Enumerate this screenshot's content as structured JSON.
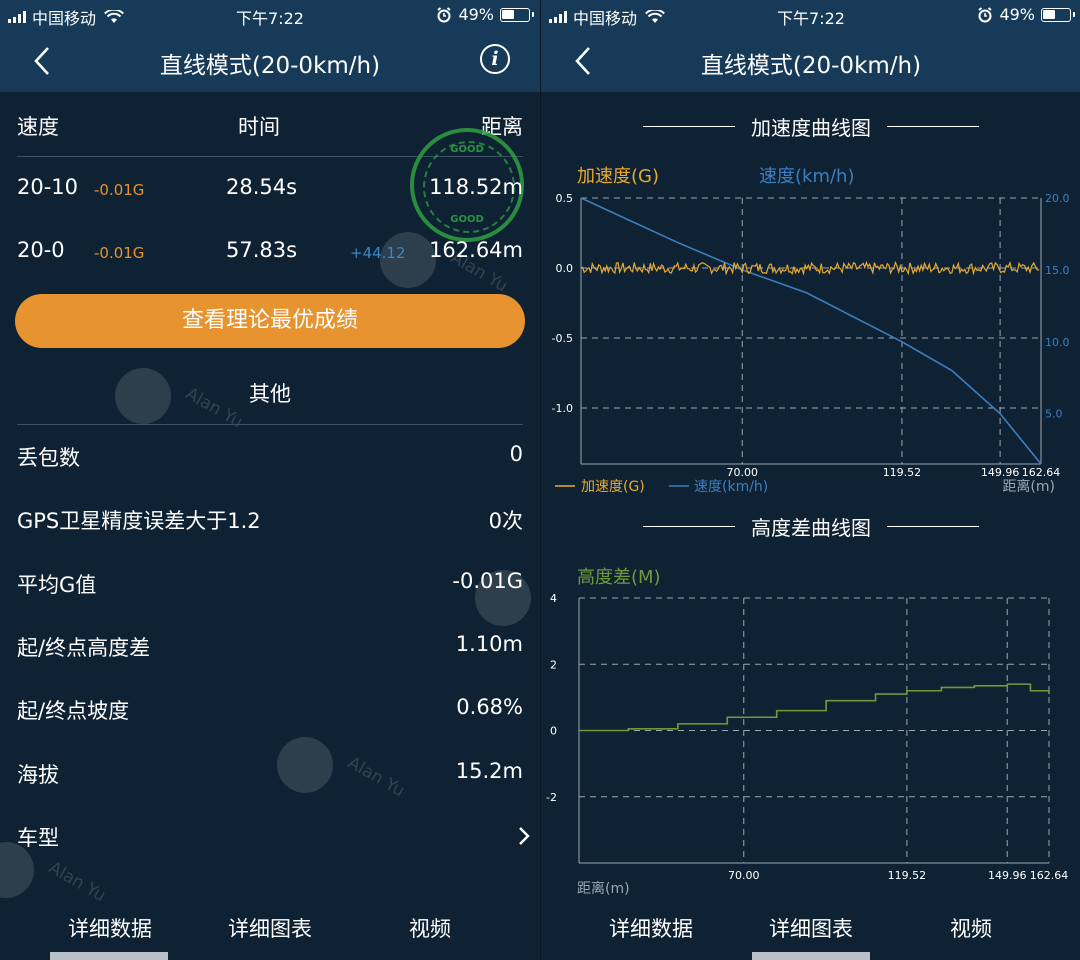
{
  "status": {
    "carrier": "中国移动",
    "time": "下午7:22",
    "battery": "49%"
  },
  "left": {
    "title": "直线模式(20-0km/h)",
    "table": {
      "headers": [
        "速度",
        "时间",
        "距离"
      ],
      "rows": [
        {
          "speed": "20-10",
          "g": "-0.01G",
          "time": "28.54s",
          "extra": "",
          "distance": "118.52m"
        },
        {
          "speed": "20-0",
          "g": "-0.01G",
          "time": "57.83s",
          "extra": "+44.12",
          "distance": "162.64m"
        }
      ]
    },
    "button": "查看理论最优成绩",
    "other_title": "其他",
    "stamp_text": "GOOD",
    "watermark": "Alan Yu",
    "items": [
      {
        "label": "丢包数",
        "value": "0"
      },
      {
        "label": "GPS卫星精度误差大于1.2",
        "value": "0次"
      },
      {
        "label": "平均G值",
        "value": "-0.01G"
      },
      {
        "label": "起/终点高度差",
        "value": "1.10m"
      },
      {
        "label": "起/终点坡度",
        "value": "0.68%"
      },
      {
        "label": "海拔",
        "value": "15.2m"
      },
      {
        "label": "车型",
        "value": ""
      }
    ]
  },
  "right": {
    "title": "直线模式(20-0km/h)",
    "accel_title": "加速度曲线图",
    "height_title": "高度差曲线图"
  },
  "tabs": [
    "详细数据",
    "详细图表",
    "视频"
  ],
  "colors": {
    "accent": "#e7932f",
    "header": "#163a57",
    "background": "#0e2233",
    "accel_line": "#e8a930",
    "speed_line": "#3b7fc1",
    "height_line": "#6f9a3c"
  },
  "chart_data": [
    {
      "type": "line",
      "title": "加速度曲线图",
      "xlabel": "距离(m)",
      "x_ticks": [
        "70.00",
        "119.52",
        "149.96",
        "162.64"
      ],
      "xlim": [
        20.0,
        162.64
      ],
      "y_left_label": "加速度(G)",
      "y_left_ticks": [
        "0.5",
        "0.0",
        "-0.5",
        "-1.0"
      ],
      "y_left_lim": [
        -1.4,
        0.5
      ],
      "y_right_label": "速度(km/h)",
      "y_right_ticks": [
        "20.0",
        "15.0",
        "10.0",
        "5.0"
      ],
      "y_right_lim": [
        1.5,
        20.0
      ],
      "legend": [
        "加速度(G)",
        "速度(km/h)"
      ],
      "legend_position": "bottom-left",
      "grid": true,
      "series": [
        {
          "name": "加速度(G)",
          "axis": "left",
          "x": [
            20,
            40,
            60,
            80,
            100,
            120,
            140,
            162.64
          ],
          "y": [
            0.0,
            0.0,
            0.0,
            0.0,
            0.0,
            0.0,
            0.0,
            0.0
          ]
        },
        {
          "name": "速度(km/h)",
          "axis": "right",
          "x": [
            20,
            50,
            70,
            90,
            119.52,
            135,
            149.96,
            162.64
          ],
          "y": [
            20.0,
            16.9,
            15.0,
            13.4,
            10.0,
            8.0,
            5.0,
            1.5
          ]
        }
      ]
    },
    {
      "type": "line",
      "title": "高度差曲线图",
      "xlabel": "距离(m)",
      "x_ticks": [
        "70.00",
        "119.52",
        "149.96",
        "162.64"
      ],
      "xlim": [
        20.0,
        162.64
      ],
      "y_label": "高度差(M)",
      "y_ticks": [
        "4",
        "2",
        "0",
        "-2"
      ],
      "ylim": [
        -4,
        4
      ],
      "grid": true,
      "series": [
        {
          "name": "高度差(M)",
          "x": [
            20,
            35,
            50,
            65,
            80,
            95,
            110,
            119.52,
            130,
            140,
            150,
            157,
            162.64
          ],
          "y": [
            0.0,
            0.05,
            0.2,
            0.4,
            0.6,
            0.9,
            1.1,
            1.2,
            1.3,
            1.35,
            1.4,
            1.2,
            1.1
          ]
        }
      ]
    }
  ]
}
